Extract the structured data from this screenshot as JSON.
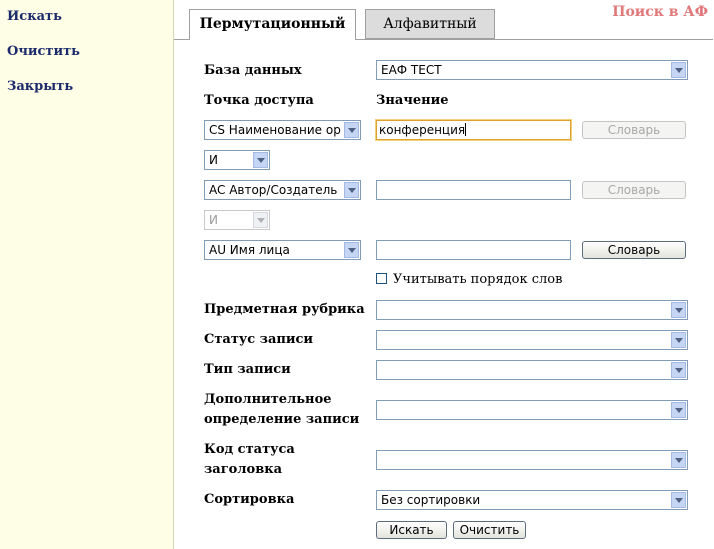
{
  "sidebar": {
    "search": "Искать",
    "clear": "Очистить",
    "close": "Закрыть"
  },
  "header": {
    "title": "Поиск в АФ",
    "tabs": [
      {
        "label": "Пермутационный",
        "active": true
      },
      {
        "label": "Алфавитный",
        "active": false
      }
    ]
  },
  "form": {
    "database_label": "База данных",
    "database_value": "ЕАФ ТЕСТ",
    "access_point_header": "Точка доступа",
    "value_header": "Значение",
    "rows": [
      {
        "access": "CS Наименование орг",
        "value": "конференция",
        "dict_label": "Словарь",
        "dict_enabled": false
      },
      {
        "access": "AC Автор/Создатель",
        "value": "",
        "dict_label": "Словарь",
        "dict_enabled": false
      },
      {
        "access": "AU Имя лица",
        "value": "",
        "dict_label": "Словарь",
        "dict_enabled": true
      }
    ],
    "operators": [
      {
        "value": "И",
        "enabled": true
      },
      {
        "value": "И",
        "enabled": false
      }
    ],
    "word_order_label": "Учитывать порядок слов",
    "word_order_checked": false,
    "subject_label": "Предметная рубрика",
    "record_status_label": "Статус записи",
    "record_type_label": "Тип записи",
    "extra_def_label_1": "Дополнительное",
    "extra_def_label_2": "определение записи",
    "heading_status_label_1": "Код статуса",
    "heading_status_label_2": "заголовка",
    "sort_label": "Сортировка",
    "sort_value": "Без сортировки",
    "search_button": "Искать",
    "clear_button": "Очистить"
  },
  "colors": {
    "sidebar_bg": "#fefde6",
    "link_color": "#1b2a6b",
    "title_color": "#e0787a"
  }
}
